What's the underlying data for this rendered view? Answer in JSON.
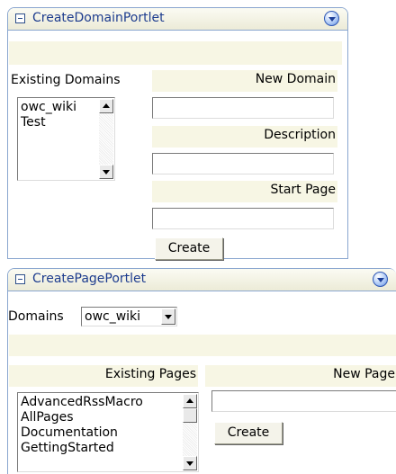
{
  "create_domain_portlet": {
    "title": "CreateDomainPortlet",
    "existing_domains_label": "Existing Domains",
    "existing_domains": [
      "owc_wiki",
      "Test"
    ],
    "new_domain_label": "New Domain",
    "new_domain_value": "",
    "description_label": "Description",
    "description_value": "",
    "start_page_label": "Start Page",
    "start_page_value": "",
    "create_label": "Create"
  },
  "create_page_portlet": {
    "title": "CreatePagePortlet",
    "domains_label": "Domains",
    "domains_selected": "owc_wiki",
    "existing_pages_label": "Existing Pages",
    "existing_pages": [
      "AdvancedRssMacro",
      "AllPages",
      "Documentation",
      "GettingStarted"
    ],
    "new_page_label": "New Page",
    "new_page_value": "",
    "create_label": "Create"
  },
  "colors": {
    "title_text": "#1d3c8e",
    "portlet_border": "#8aa6cf",
    "band_background": "#f7f6e4"
  },
  "icons": [
    "minimize-icon",
    "portlet-menu-icon",
    "scroll-up-icon",
    "scroll-down-icon",
    "dropdown-arrow-icon"
  ]
}
